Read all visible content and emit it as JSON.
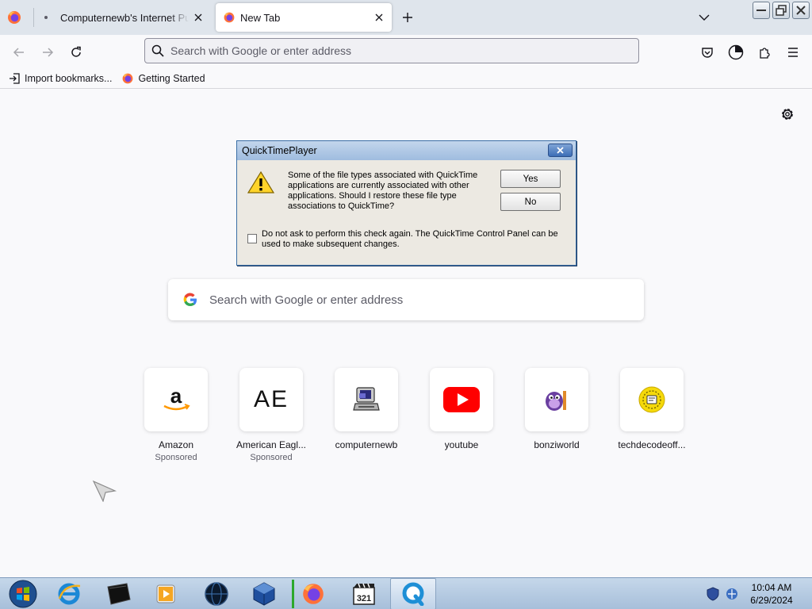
{
  "tabs": [
    {
      "title": "Computernewb's Internet Pub",
      "active": false
    },
    {
      "title": "New Tab",
      "active": true
    }
  ],
  "urlbar": {
    "placeholder": "Search with Google or enter address"
  },
  "bookmarks": [
    {
      "label": "Import bookmarks...",
      "icon": "import-icon"
    },
    {
      "label": "Getting Started",
      "icon": "firefox-icon"
    }
  ],
  "newtab": {
    "search_placeholder": "Search with Google or enter address",
    "shortcuts": [
      {
        "label": "Amazon",
        "sponsored": "Sponsored",
        "icon": "amazon-icon"
      },
      {
        "label": "American Eagl...",
        "sponsored": "Sponsored",
        "icon": "ae-icon",
        "icon_text": "AE"
      },
      {
        "label": "computernewb",
        "sponsored": "",
        "icon": "computer-icon"
      },
      {
        "label": "youtube",
        "sponsored": "",
        "icon": "youtube-icon"
      },
      {
        "label": "bonziworld",
        "sponsored": "",
        "icon": "bonzi-icon"
      },
      {
        "label": "techdecodeoff...",
        "sponsored": "",
        "icon": "techdecode-icon"
      }
    ]
  },
  "dialog": {
    "title": "QuickTimePlayer",
    "message": "Some of the file types associated with QuickTime applications are currently associated with other applications.  Should I restore these file type associations to QuickTime?",
    "yes_label": "Yes",
    "no_label": "No",
    "checkbox_label": "Do not ask to perform this check again.  The QuickTime Control Panel can be used to make subsequent changes.",
    "checkbox_checked": false
  },
  "taskbar": {
    "items": [
      "start-orb-icon",
      "internet-explorer-icon",
      "media-device-icon",
      "media-player-icon",
      "dark-globe-icon",
      "virtualbox-icon",
      "firefox-icon",
      "media-player-classic-icon",
      "quicktime-icon"
    ],
    "time": "10:04 AM",
    "date": "6/29/2024"
  },
  "colors": {
    "accent": "#0061e0",
    "youtube_red": "#ff0000",
    "dialog_bg": "#ece9e2"
  }
}
